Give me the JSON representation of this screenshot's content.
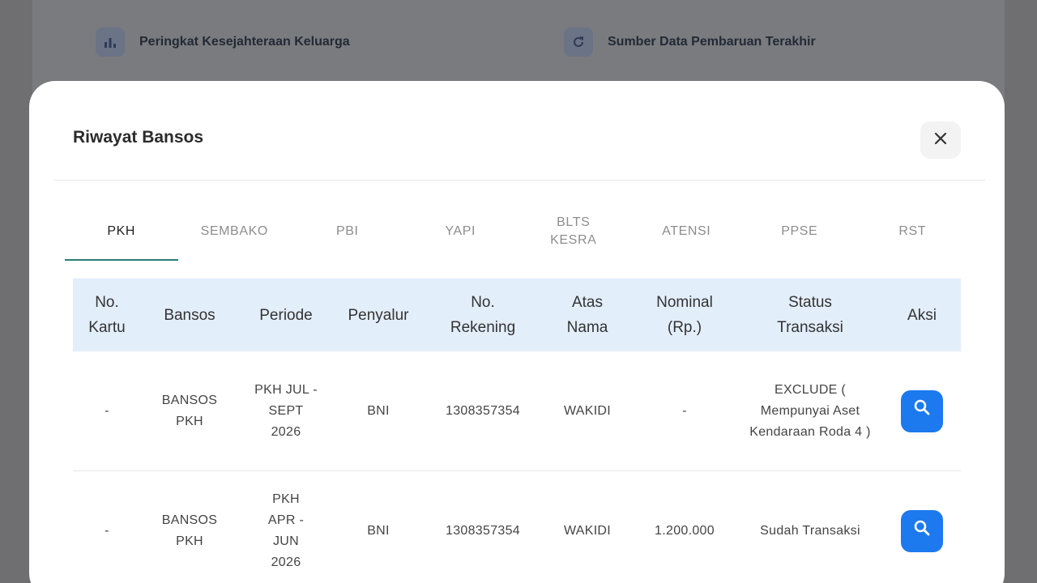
{
  "background": {
    "items": [
      {
        "label": "Peringkat Kesejahteraan Keluarga",
        "icon": "bar-chart-icon"
      },
      {
        "label": "Sumber Data Pembaruan Terakhir",
        "icon": "refresh-icon"
      }
    ]
  },
  "modal": {
    "title": "Riwayat Bansos",
    "close_icon": "close-icon"
  },
  "tabs": [
    {
      "label": "PKH",
      "active": true
    },
    {
      "label": "SEMBAKO"
    },
    {
      "label": "PBI"
    },
    {
      "label": "YAPI"
    },
    {
      "label": "BLTS KESRA"
    },
    {
      "label": "ATENSI"
    },
    {
      "label": "PPSE"
    },
    {
      "label": "RST"
    }
  ],
  "table": {
    "headers": [
      "No. Kartu",
      "Bansos",
      "Periode",
      "Penyalur",
      "No. Rekening",
      "Atas Nama",
      "Nominal (Rp.)",
      "Status Transaksi",
      "Aksi"
    ],
    "rows": [
      {
        "no_kartu": "-",
        "bansos": "BANSOS PKH",
        "periode": "PKH JUL - SEPT 2026",
        "penyalur": "BNI",
        "no_rekening": "1308357354",
        "atas_nama": "WAKIDI",
        "nominal": "-",
        "status": "EXCLUDE ( Mempunyai Aset Kendaraan Roda 4 )"
      },
      {
        "no_kartu": "-",
        "bansos": "BANSOS PKH",
        "periode": "PKH APR - JUN 2026",
        "penyalur": "BNI",
        "no_rekening": "1308357354",
        "atas_nama": "WAKIDI",
        "nominal": "1.200.000",
        "status": "Sudah Transaksi"
      }
    ]
  },
  "colors": {
    "accent": "#1c79ee",
    "tab_indicator": "#2b7d73",
    "header_bg": "#e3eefb"
  }
}
